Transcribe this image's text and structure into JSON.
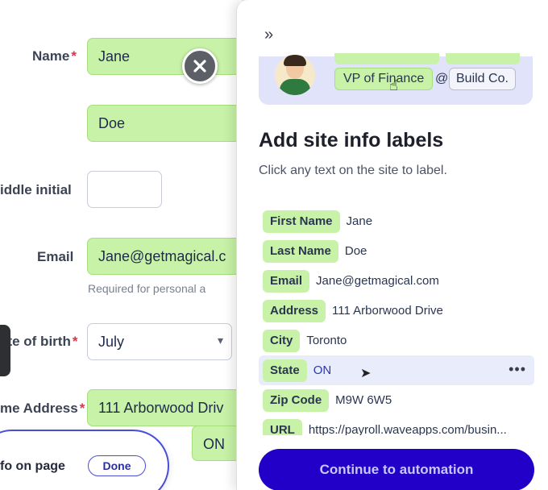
{
  "form": {
    "name_label": "Name",
    "required_mark": "*",
    "first_name_value": "Jane",
    "last_name_value": "Doe",
    "middle_initial_label": "iddle initial",
    "email_label": "Email",
    "email_value": "Jane@getmagical.c",
    "email_helper": "Required for personal a",
    "dob_label": "ate of birth",
    "dob_value": "July",
    "address_label": "me Address",
    "address_value": "111 Arborwood Driv",
    "state_value": "ON"
  },
  "info_pill": {
    "label": "fo on page",
    "done_label": "Done"
  },
  "panel": {
    "collapse_icon": "»",
    "preview": {
      "job_title": "VP of Finance",
      "at_sign": "@",
      "company": "Build Co."
    },
    "title": "Add site info labels",
    "subtitle": "Click any text on the site to label.",
    "labels": [
      {
        "field": "First Name",
        "value": "Jane"
      },
      {
        "field": "Last Name",
        "value": "Doe"
      },
      {
        "field": "Email",
        "value": "Jane@getmagical.com"
      },
      {
        "field": "Address",
        "value": "111 Arborwood Drive"
      },
      {
        "field": "City",
        "value": "Toronto"
      },
      {
        "field": "State",
        "value": "ON"
      },
      {
        "field": "Zip Code",
        "value": "M9W 6W5"
      },
      {
        "field": "URL",
        "value": "https://payroll.waveapps.com/busin..."
      }
    ],
    "more_icon": "•••",
    "continue_label": "Continue to automation"
  },
  "colors": {
    "accent": "#2200c7",
    "label_green": "#c8f2a7",
    "preview_bg": "#e1e3fb"
  }
}
